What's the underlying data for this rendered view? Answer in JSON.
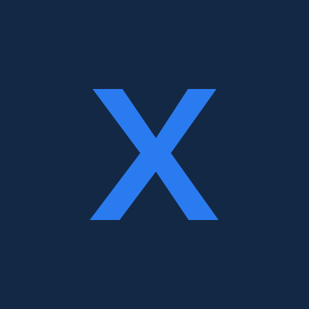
{
  "logo": {
    "icon": "x-logo-icon",
    "letter": "X"
  },
  "colors": {
    "background": "#132844",
    "accent": "#2B7BF0"
  }
}
